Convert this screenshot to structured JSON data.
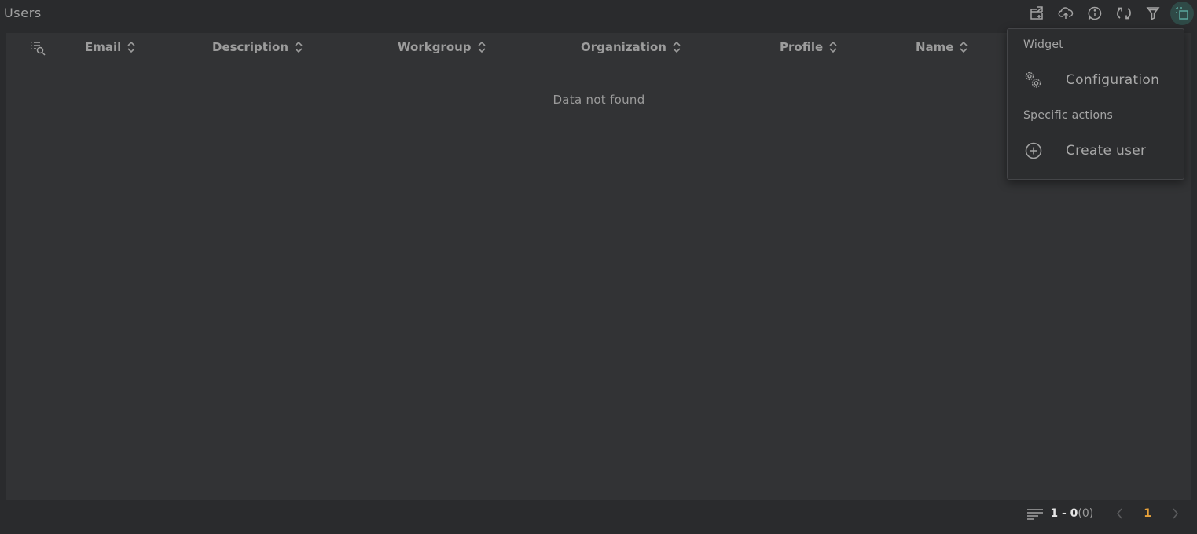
{
  "widget": {
    "title": "Users"
  },
  "toolbar": {
    "buttons": [
      {
        "name": "export-icon",
        "label": "Export"
      },
      {
        "name": "upload-icon",
        "label": "Upload"
      },
      {
        "name": "info-icon",
        "label": "Info"
      },
      {
        "name": "refresh-icon",
        "label": "Refresh"
      },
      {
        "name": "filter-icon",
        "label": "Filter"
      },
      {
        "name": "widget-menu-icon",
        "label": "Widget menu",
        "active": true
      }
    ]
  },
  "table": {
    "columns": [
      {
        "label": "Email",
        "sortable": true
      },
      {
        "label": "Description",
        "sortable": true
      },
      {
        "label": "Workgroup",
        "sortable": true
      },
      {
        "label": "Organization",
        "sortable": true
      },
      {
        "label": "Profile",
        "sortable": true
      },
      {
        "label": "Name",
        "sortable": true
      }
    ],
    "rows": [],
    "empty_message": "Data not found"
  },
  "pagination": {
    "range": "1 - 0",
    "total": "(0)",
    "current_page": "1"
  },
  "dropdown": {
    "sections": [
      {
        "title": "Widget",
        "items": [
          {
            "label": "Configuration",
            "icon": "gears-icon"
          }
        ]
      },
      {
        "title": "Specific actions",
        "items": [
          {
            "label": "Create user",
            "icon": "plus-circle-icon"
          }
        ]
      }
    ]
  },
  "colors": {
    "background": "#2a2b2d",
    "panel": "#323335",
    "accent_page": "#e8a23a",
    "active_tool": "#2f4a47",
    "active_tool_icon": "#5aa89d"
  }
}
